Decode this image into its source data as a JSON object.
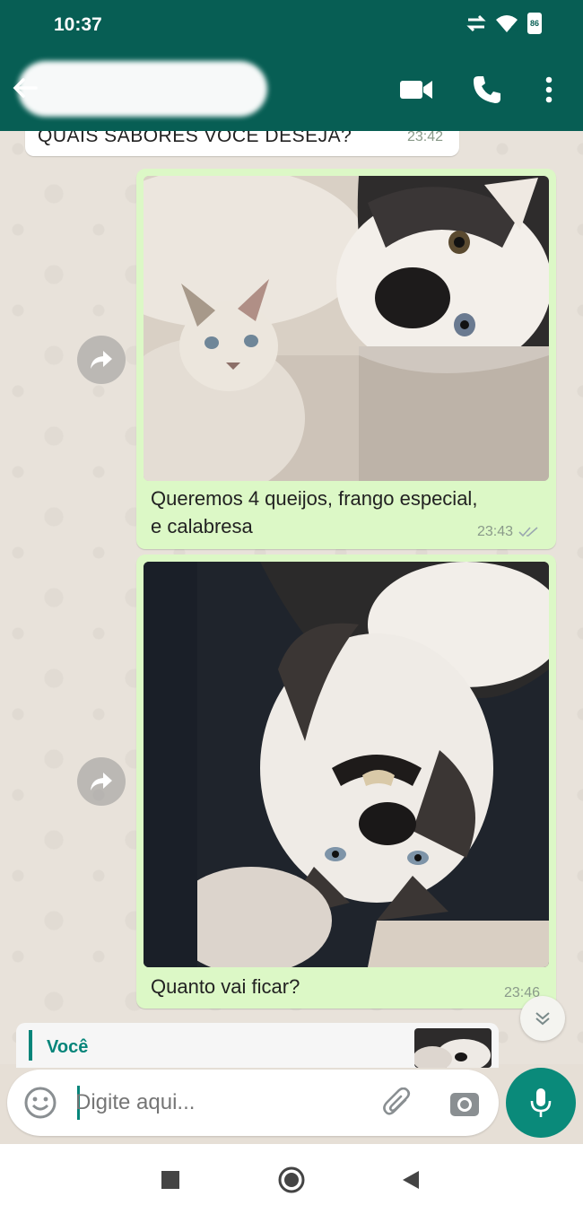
{
  "status_bar": {
    "time": "10:37",
    "battery": "86"
  },
  "header": {
    "contact_name": ""
  },
  "messages": [
    {
      "type": "incoming-text",
      "text": "QUAIS SABORES VOCÊ DESEJA?",
      "time": "23:42"
    },
    {
      "type": "outgoing-image",
      "caption_line1": "Queremos 4 queijos, frango especial,",
      "caption_line2": "e calabresa",
      "time": "23:43",
      "status": "read"
    },
    {
      "type": "outgoing-image",
      "caption": "Quanto vai ficar?",
      "time": "23:46",
      "status": "sent"
    }
  ],
  "reply_preview": {
    "author": "Você"
  },
  "composer": {
    "placeholder": "Digite aqui..."
  },
  "colors": {
    "header": "#075e54",
    "accent": "#0a8a7a",
    "outgoing_bubble": "#dcf8c6",
    "incoming_bubble": "#ffffff"
  }
}
